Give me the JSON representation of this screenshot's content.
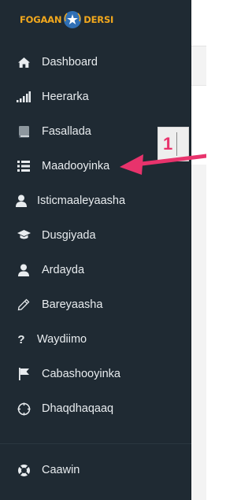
{
  "brand": {
    "left": "FOGAAN",
    "right": "DERSI",
    "accent": "#f2a81d"
  },
  "colors": {
    "sidebar_bg": "#1f2a33",
    "text": "#e8ecef",
    "annotation": "#e8336c"
  },
  "nav": {
    "items": [
      {
        "label": "Dashboard",
        "icon": "home-icon"
      },
      {
        "label": "Heerarka",
        "icon": "signal-bars-icon"
      },
      {
        "label": "Fasallada",
        "icon": "book-icon"
      },
      {
        "label": "Maadooyinka",
        "icon": "list-icon"
      },
      {
        "label": "Isticmaaleyaasha",
        "icon": "user-icon"
      },
      {
        "label": "Dusgiyada",
        "icon": "graduation-cap-icon"
      },
      {
        "label": "Ardayda",
        "icon": "person-icon"
      },
      {
        "label": "Bareyaasha",
        "icon": "pencil-icon"
      },
      {
        "label": "Waydiimo",
        "icon": "question-icon"
      },
      {
        "label": "Cabashooyinka",
        "icon": "flag-icon"
      },
      {
        "label": "Dhaqdhaqaaq",
        "icon": "crosshair-icon"
      }
    ],
    "help": {
      "label": "Caawin",
      "icon": "life-ring-icon"
    }
  },
  "annotation": {
    "step": "1"
  }
}
